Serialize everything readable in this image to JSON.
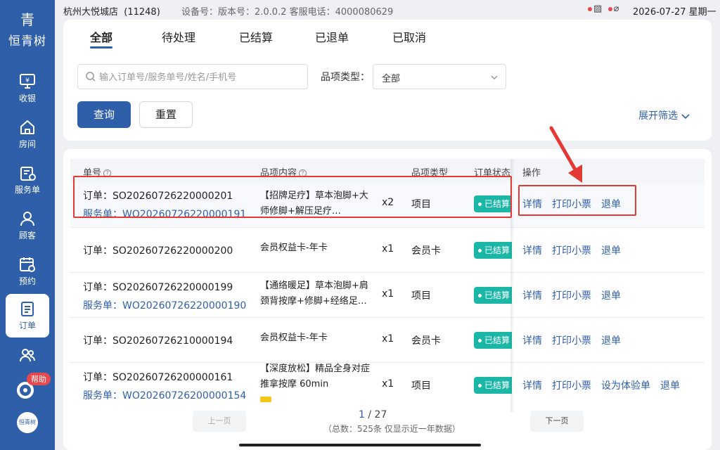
{
  "brand": {
    "logo_mark": "青",
    "name": "恒青树",
    "bottom_logo_text": "恒青树"
  },
  "status_bar": {
    "store": "杭州大悦城店",
    "store_id": "(11248)",
    "device_info": "设备号：版本号：2.0.0.2  客服电话：4000080629",
    "datetime": "2026-07-27 星期一"
  },
  "sidebar": {
    "items": [
      {
        "label": "收银",
        "icon": "cashier-icon"
      },
      {
        "label": "房间",
        "icon": "home-icon"
      },
      {
        "label": "服务单",
        "icon": "service-order-icon"
      },
      {
        "label": "顾客",
        "icon": "user-icon"
      },
      {
        "label": "预约",
        "icon": "calendar-icon"
      },
      {
        "label": "订单",
        "icon": "order-icon",
        "active": true
      },
      {
        "label": "",
        "icon": "group-icon"
      }
    ],
    "help_badge": "帮助"
  },
  "tabs": [
    "全部",
    "待处理",
    "已结算",
    "已退单",
    "已取消"
  ],
  "filters": {
    "search_placeholder": "输入订单号/服务单号/姓名/手机号",
    "type_label": "品项类型：",
    "type_value": "全部",
    "query_button": "查询",
    "reset_button": "重置",
    "expand_label": "展开筛选"
  },
  "table": {
    "headers": {
      "order_no": "单号",
      "content": "品项内容",
      "type": "品项类型",
      "status": "订单状态",
      "actions": "操作"
    },
    "rows": [
      {
        "order": "订单：SO20260726220000201",
        "service": "服务单：WO20260726220000191",
        "content": "【招牌足疗】草本泡脚+大师修脚+解压足疗…",
        "qty": "x2",
        "type": "项目",
        "status": "已结算",
        "actions": [
          "详情",
          "打印小票",
          "退单"
        ]
      },
      {
        "order": "订单：SO20260726220000200",
        "service": "",
        "content": "会员权益卡-年卡",
        "qty": "x1",
        "type": "会员卡",
        "status": "已结算",
        "actions": [
          "详情",
          "打印小票",
          "退单"
        ]
      },
      {
        "order": "订单：SO20260726220000199",
        "service": "服务单：WO20260726220000190",
        "content": "【通络暖足】草本泡脚+肩颈背按摩+修脚+经络足…",
        "qty": "x1",
        "type": "项目",
        "status": "已结算",
        "actions": [
          "详情",
          "打印小票",
          "退单"
        ]
      },
      {
        "order": "订单：SO20260726210000194",
        "service": "",
        "content": "会员权益卡-年卡",
        "qty": "x1",
        "type": "会员卡",
        "status": "已结算",
        "actions": [
          "详情",
          "打印小票",
          "退单"
        ]
      },
      {
        "order": "订单：SO20260726200000161",
        "service": "服务单：WO20260726200000154",
        "content": "【深度放松】精品全身对症推拿按摩 60min",
        "qty": "x1",
        "type": "项目",
        "status": "已结算",
        "actions": [
          "详情",
          "打印小票",
          "设为体验单",
          "退单"
        ]
      }
    ]
  },
  "pagination": {
    "prev": "上一页",
    "next": "下一页",
    "current": "1",
    "sep": " / ",
    "total_pages": "27",
    "total_text": "（总数：525条 仅显示近一年数据）"
  },
  "colors": {
    "primary": "#2f5fa8",
    "status_teal": "#1ab7a7",
    "annotation_red": "#e53935"
  }
}
